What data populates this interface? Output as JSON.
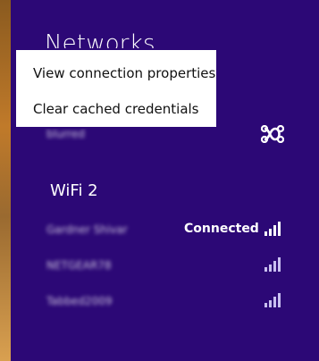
{
  "title": "Networks",
  "context_menu": {
    "items": [
      {
        "label": "View connection properties"
      },
      {
        "label": "Clear cached credentials"
      }
    ]
  },
  "sections": [
    {
      "name": "",
      "networks": [
        {
          "name": "blurred",
          "icon": "hotspot-icon"
        }
      ]
    },
    {
      "name": "WiFi 2",
      "networks": [
        {
          "name": "Gardner Shivar",
          "status": "Connected",
          "signal": 4
        },
        {
          "name": "NETGEAR78",
          "signal": 4
        },
        {
          "name": "Tabbed2009",
          "signal": 4
        }
      ]
    }
  ],
  "colors": {
    "panel": "#2c0876",
    "menu_bg": "#ffffff",
    "text": "#ffffff"
  }
}
